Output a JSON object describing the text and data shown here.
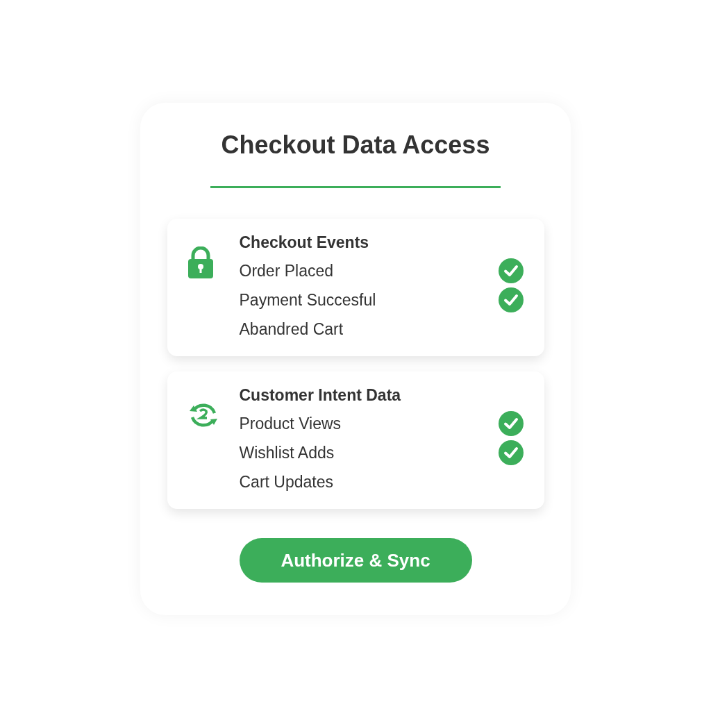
{
  "title": "Checkout Data Access",
  "sections": [
    {
      "kind": "lock",
      "heading": "Checkout Events",
      "items": [
        {
          "label": "Order Placed",
          "checked": true
        },
        {
          "label": "Payment Succesful",
          "checked": true
        },
        {
          "label": "Abandred Cart",
          "checked": false
        }
      ]
    },
    {
      "kind": "sync",
      "heading": "Customer Intent Data",
      "items": [
        {
          "label": "Product Views",
          "checked": true
        },
        {
          "label": "Wishlist Adds",
          "checked": true
        },
        {
          "label": "Cart Updates",
          "checked": false
        }
      ]
    }
  ],
  "button": "Authorize & Sync"
}
